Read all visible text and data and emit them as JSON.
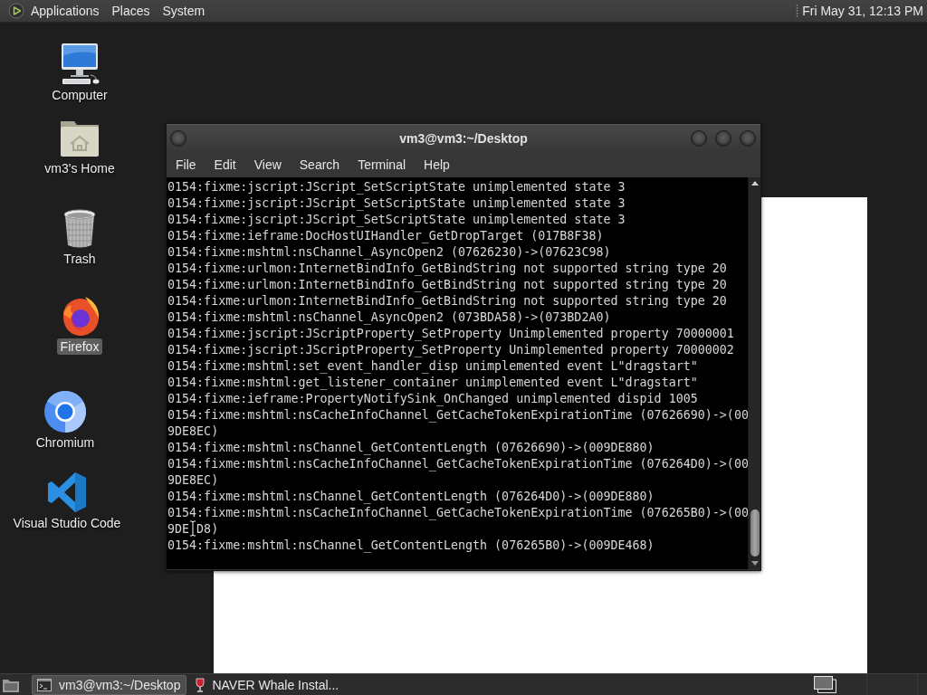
{
  "top_panel": {
    "menus": [
      "Applications",
      "Places",
      "System"
    ],
    "clock": "Fri May 31, 12:13 PM"
  },
  "desktop_icons": [
    {
      "kind": "computer",
      "label": "Computer",
      "selected": false
    },
    {
      "kind": "home",
      "label": "vm3's Home",
      "selected": false
    },
    {
      "kind": "trash",
      "label": "Trash",
      "selected": false
    },
    {
      "kind": "firefox",
      "label": "Firefox",
      "selected": true
    },
    {
      "kind": "chromium",
      "label": "Chromium",
      "selected": false
    },
    {
      "kind": "vscode",
      "label": "Visual Studio Code",
      "selected": false
    }
  ],
  "terminal": {
    "title": "vm3@vm3:~/Desktop",
    "menus": [
      "File",
      "Edit",
      "View",
      "Search",
      "Terminal",
      "Help"
    ],
    "lines": [
      "0154:fixme:jscript:JScript_SetScriptState unimplemented state 3",
      "0154:fixme:jscript:JScript_SetScriptState unimplemented state 3",
      "0154:fixme:jscript:JScript_SetScriptState unimplemented state 3",
      "0154:fixme:ieframe:DocHostUIHandler_GetDropTarget (017B8F38)",
      "0154:fixme:mshtml:nsChannel_AsyncOpen2 (07626230)->(07623C98)",
      "0154:fixme:urlmon:InternetBindInfo_GetBindString not supported string type 20",
      "0154:fixme:urlmon:InternetBindInfo_GetBindString not supported string type 20",
      "0154:fixme:urlmon:InternetBindInfo_GetBindString not supported string type 20",
      "0154:fixme:mshtml:nsChannel_AsyncOpen2 (073BDA58)->(073BD2A0)",
      "0154:fixme:jscript:JScriptProperty_SetProperty Unimplemented property 70000001",
      "0154:fixme:jscript:JScriptProperty_SetProperty Unimplemented property 70000002",
      "0154:fixme:mshtml:set_event_handler_disp unimplemented event L\"dragstart\"",
      "0154:fixme:mshtml:get_listener_container unimplemented event L\"dragstart\"",
      "0154:fixme:ieframe:PropertyNotifySink_OnChanged unimplemented dispid 1005",
      "0154:fixme:mshtml:nsCacheInfoChannel_GetCacheTokenExpirationTime (07626690)->(00",
      "9DE8EC)",
      "0154:fixme:mshtml:nsChannel_GetContentLength (07626690)->(009DE880)",
      "0154:fixme:mshtml:nsCacheInfoChannel_GetCacheTokenExpirationTime (076264D0)->(00",
      "9DE8EC)",
      "0154:fixme:mshtml:nsChannel_GetContentLength (076264D0)->(009DE880)",
      "0154:fixme:mshtml:nsCacheInfoChannel_GetCacheTokenExpirationTime (076265B0)->(00",
      {
        "parts": [
          "9DE",
          "D8)"
        ]
      },
      "0154:fixme:mshtml:nsChannel_GetContentLength (076265B0)->(009DE468)"
    ]
  },
  "taskbar": {
    "tasks": [
      {
        "kind": "terminal",
        "label": "vm3@vm3:~/Desktop",
        "selected": true
      },
      {
        "kind": "installer",
        "label": "NAVER Whale Instal...",
        "selected": false
      }
    ]
  }
}
